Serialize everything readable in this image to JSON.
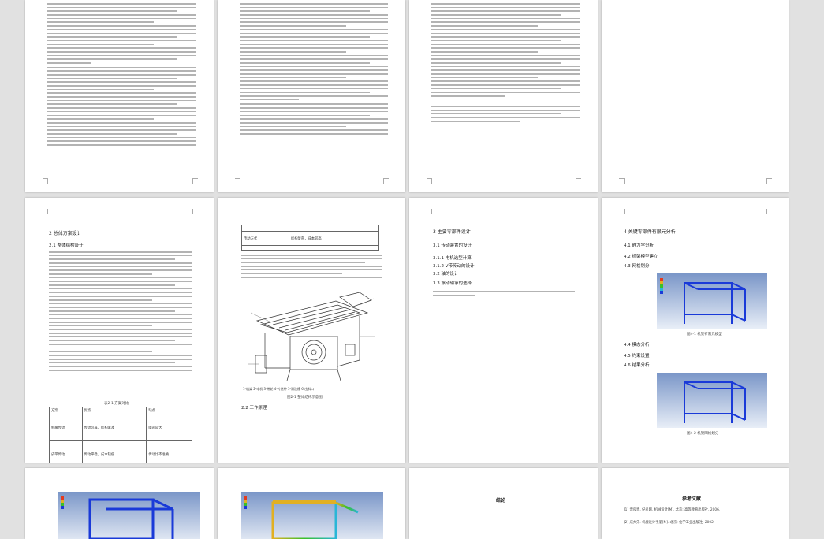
{
  "colors": {
    "workspace_bg": "#e1e1e1",
    "page_bg": "#ffffff",
    "fea_cold": "#1a3ad8",
    "fea_warm": "#e2b023",
    "fea_hot": "#e23b1f"
  },
  "pages": {
    "p5": {
      "heading": "2 总体方案设计",
      "subheading": "2.1 整体结构设计",
      "table_title": "表2-1 方案对比",
      "table": {
        "headers": [
          "方案",
          "优点",
          "缺点"
        ],
        "rows": [
          [
            "机械传动",
            "传动可靠，结构紧凑",
            "噪声较大"
          ],
          [
            "皮带传动",
            "传动平稳，成本较低",
            "传动比不准确"
          ]
        ]
      }
    },
    "p6": {
      "table_rows": [
        [
          "",
          ""
        ],
        [
          "传动方式",
          "结构复杂，成本较高"
        ],
        [
          "",
          ""
        ]
      ],
      "caption": "图2-1 整体结构示意图",
      "legend": "1-机架 2-电机 3-带轮 4-传送带 5-清洗槽 6-出料口",
      "subheading": "2.2 工作原理"
    },
    "p7": {
      "heading": "3 主要零部件设计",
      "sections": [
        "3.1 传动装置的设计",
        "3.1.1 电机选型计算",
        "3.1.2 V带传动的设计",
        "3.2 轴的设计",
        "3.3 滚动轴承的选择"
      ]
    },
    "p8": {
      "heading": "4 关键零部件有限元分析",
      "sections": [
        "4.1 静力学分析",
        "4.2 机架模型建立",
        "4.3 网格划分"
      ],
      "figure_caption_1": "图4-1 机架有限元模型",
      "sections_2": [
        "4.4 模态分析",
        "4.5 约束设置",
        "4.6 结果分析"
      ],
      "figure_caption_2": "图4-2 机架网格划分"
    },
    "p11": {
      "heading": "结论"
    },
    "p12": {
      "heading": "参考文献",
      "refs": [
        "[1] 濮良贵, 纪名刚. 机械设计[M]. 北京: 高等教育出版社, 2006.",
        "[2] 成大先. 机械设计手册[M]. 北京: 化学工业出版社, 2002."
      ]
    }
  }
}
